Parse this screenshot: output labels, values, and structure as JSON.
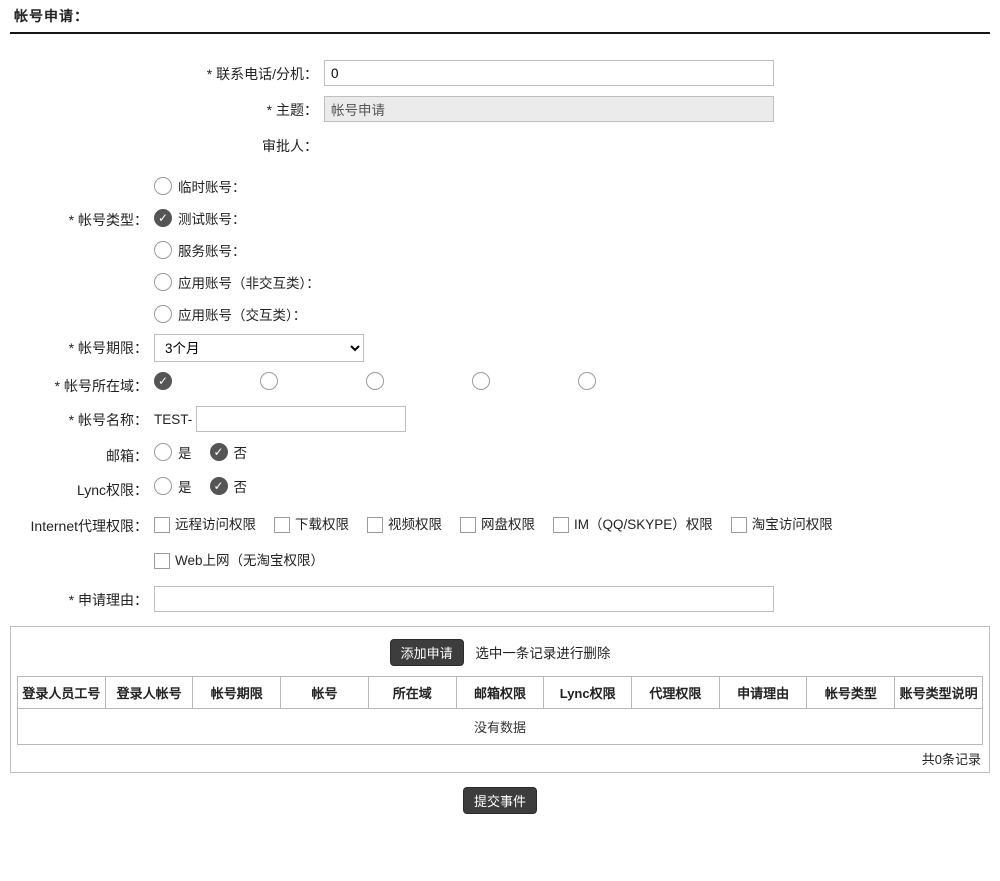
{
  "header": {
    "title": "帐号申请："
  },
  "form": {
    "phone": {
      "label": "* 联系电话/分机：",
      "value": "0"
    },
    "subject": {
      "label": "* 主题：",
      "value": "帐号申请"
    },
    "approver": {
      "label": "审批人："
    },
    "acct_type": {
      "label": "* 帐号类型：",
      "options": {
        "o1": "临时账号：",
        "o2": "测试账号：",
        "o3": "服务账号：",
        "o4": "应用账号（非交互类）：",
        "o5": "应用账号（交互类）："
      }
    },
    "period": {
      "label": "* 帐号期限：",
      "selected": "3个月"
    },
    "domain": {
      "label": "* 帐号所在域："
    },
    "acct_name": {
      "label": "* 帐号名称：",
      "prefix": "TEST-",
      "value": ""
    },
    "mail": {
      "label": "邮箱：",
      "yes": "是",
      "no": "否"
    },
    "lync": {
      "label": "Lync权限：",
      "yes": "是",
      "no": "否"
    },
    "proxy": {
      "label": "Internet代理权限：",
      "chk": {
        "c1": "远程访问权限",
        "c2": "下载权限",
        "c3": "视频权限",
        "c4": "网盘权限",
        "c5": "IM（QQ/SKYPE）权限",
        "c6": "淘宝访问权限",
        "c7": "Web上网（无淘宝权限）"
      }
    },
    "reason": {
      "label": "* 申请理由：",
      "value": ""
    }
  },
  "tablebar": {
    "add": "添加申请",
    "hint": "选中一条记录进行删除"
  },
  "table": {
    "cols": {
      "c1": "登录人员工号",
      "c2": "登录人帐号",
      "c3": "帐号期限",
      "c4": "帐号",
      "c5": "所在域",
      "c6": "邮箱权限",
      "c7": "Lync权限",
      "c8": "代理权限",
      "c9": "申请理由",
      "c10": "帐号类型",
      "c11": "账号类型说明"
    },
    "empty": "没有数据",
    "count": "共0条记录"
  },
  "submit": {
    "label": "提交事件"
  }
}
